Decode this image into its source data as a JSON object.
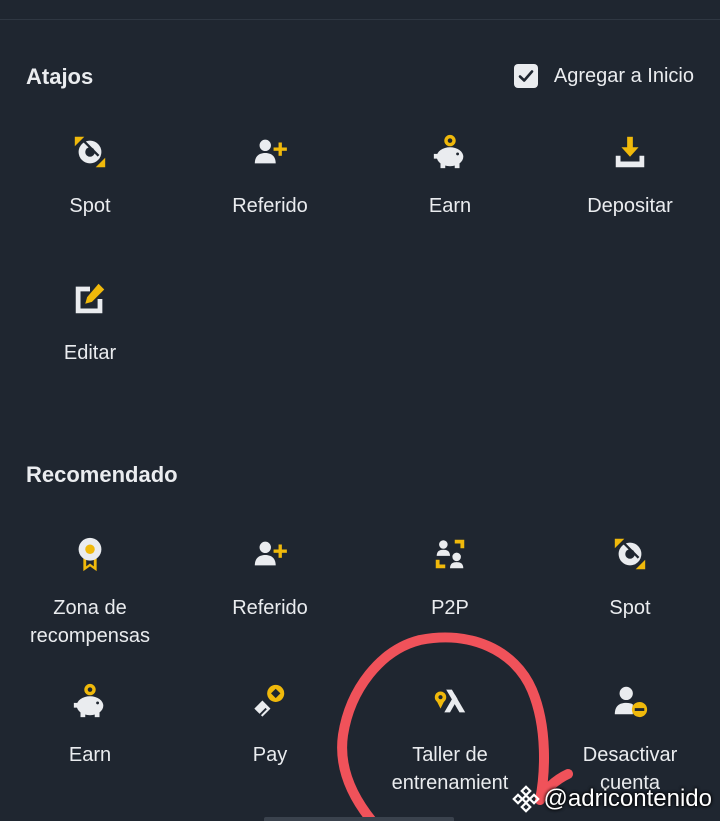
{
  "shortcuts": {
    "title": "Atajos",
    "add_home_label": "Agregar a Inicio",
    "add_home_checked": true,
    "items": [
      {
        "label": "Spot",
        "icon": "spot-icon"
      },
      {
        "label": "Referido",
        "icon": "referral-icon"
      },
      {
        "label": "Earn",
        "icon": "earn-icon"
      },
      {
        "label": "Depositar",
        "icon": "deposit-icon"
      },
      {
        "label": "Editar",
        "icon": "edit-icon"
      }
    ]
  },
  "recommended": {
    "title": "Recomendado",
    "items": [
      {
        "label": "Zona de\nrecompensas",
        "icon": "rewards-icon"
      },
      {
        "label": "Referido",
        "icon": "referral-icon"
      },
      {
        "label": "P2P",
        "icon": "p2p-icon"
      },
      {
        "label": "Spot",
        "icon": "spot-icon"
      },
      {
        "label": "Earn",
        "icon": "earn-icon"
      },
      {
        "label": "Pay",
        "icon": "pay-icon"
      },
      {
        "label": "Taller de\nentrenamient",
        "icon": "training-icon"
      },
      {
        "label": "Desactivar\ncuenta",
        "icon": "deactivate-account-icon"
      }
    ]
  },
  "watermark": "@adricontenido",
  "colors": {
    "background": "#1f2630",
    "text": "#eaecef",
    "icon_gray": "#eaecef",
    "accent_yellow": "#f0b90b",
    "annotation_red": "#f0525a"
  }
}
